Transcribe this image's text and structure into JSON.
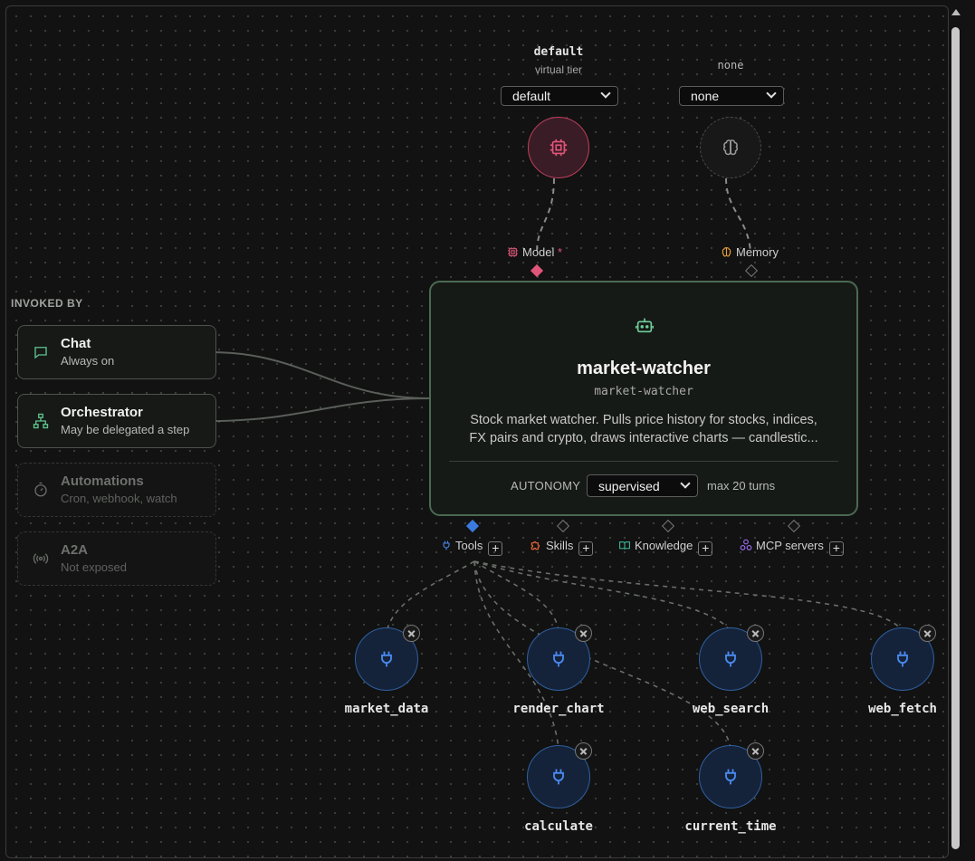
{
  "model_tier": {
    "title": "default",
    "subtitle": "virtual tier",
    "selected": "default"
  },
  "memory_tier": {
    "title": "none",
    "selected": "none"
  },
  "ports_top": {
    "model": {
      "label": "Model",
      "required_mark": "*"
    },
    "memory": {
      "label": "Memory"
    }
  },
  "invoked_by": {
    "heading": "INVOKED BY",
    "items": [
      {
        "title": "Chat",
        "subtitle": "Always on",
        "icon": "chat-bubble-icon",
        "active": true
      },
      {
        "title": "Orchestrator",
        "subtitle": "May be delegated a step",
        "icon": "hierarchy-icon",
        "active": true
      },
      {
        "title": "Automations",
        "subtitle": "Cron, webhook, watch",
        "icon": "timer-icon",
        "active": false
      },
      {
        "title": "A2A",
        "subtitle": "Not exposed",
        "icon": "broadcast-icon",
        "active": false
      }
    ]
  },
  "agent": {
    "icon": "robot-icon",
    "name": "market-watcher",
    "slug": "market-watcher",
    "description_line1": "Stock market watcher. Pulls price history for stocks, indices,",
    "description_line2": "FX pairs and crypto, draws interactive charts — candlestic...",
    "autonomy_label": "AUTONOMY",
    "autonomy_value": "supervised",
    "max_turns": "max 20 turns"
  },
  "ports_bottom": [
    {
      "label": "Tools",
      "icon": "plug-icon",
      "color": "#4a86e8"
    },
    {
      "label": "Skills",
      "icon": "puzzle-icon",
      "color": "#e8663a"
    },
    {
      "label": "Knowledge",
      "icon": "book-icon",
      "color": "#3fb59a"
    },
    {
      "label": "MCP servers",
      "icon": "cluster-icon",
      "color": "#9a6cf0"
    }
  ],
  "tools": [
    {
      "name": "market_data"
    },
    {
      "name": "render_chart"
    },
    {
      "name": "web_search"
    },
    {
      "name": "web_fetch"
    },
    {
      "name": "calculate"
    },
    {
      "name": "current_time"
    }
  ],
  "colors": {
    "model_accent": "#e0557a",
    "memory_accent": "#555555",
    "agent_border": "#4a6a52",
    "agent_icon": "#6fcf9a",
    "tool_accent": "#3b7be0",
    "memory_icon": "#e8a23a"
  }
}
